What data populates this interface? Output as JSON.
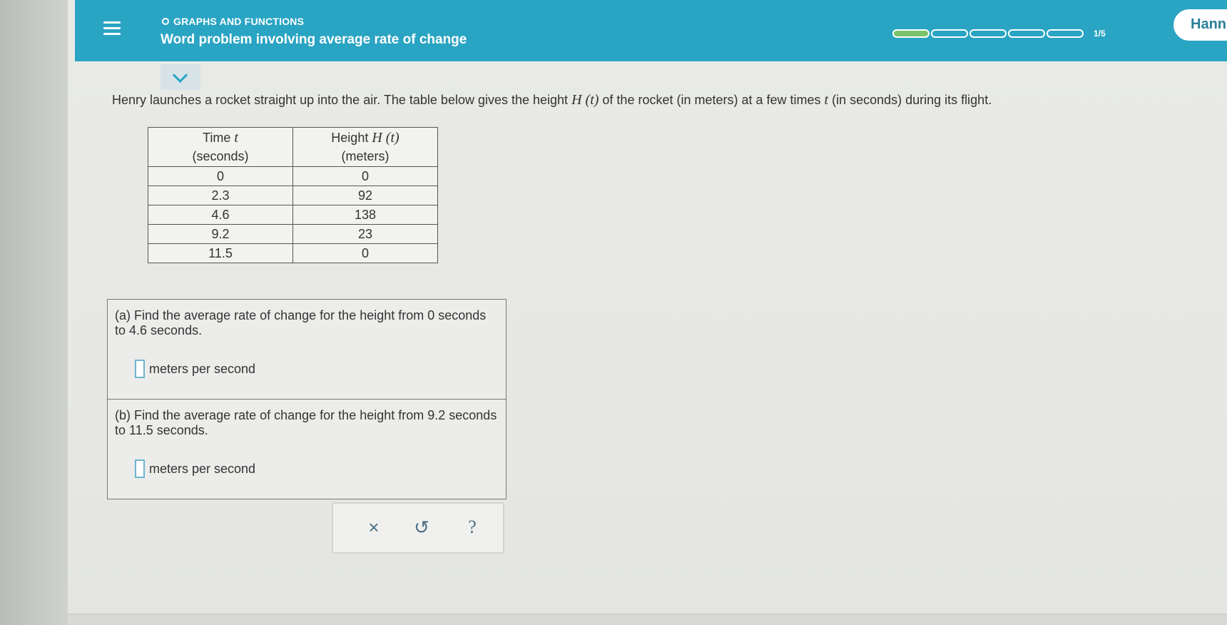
{
  "header": {
    "topic": "GRAPHS AND FUNCTIONS",
    "title": "Word problem involving average rate of change",
    "progress_text": "1/5",
    "progress_filled": 1,
    "progress_total": 5,
    "user_name": "Hann"
  },
  "problem": {
    "part1": "Henry launches a rocket straight up into the air. The table below gives the height ",
    "Hsym": "H",
    "tsym": "t",
    "part2": " of the rocket (in meters) at a few times ",
    "part3": " (in seconds) during its flight."
  },
  "table": {
    "col1_line1": "Time",
    "col1_var": "t",
    "col1_line2": "(seconds)",
    "col2_line1": "Height",
    "col2_var": "H",
    "col2_arg": "t",
    "col2_line2": "(meters)",
    "rows": [
      {
        "t": "0",
        "h": "0"
      },
      {
        "t": "2.3",
        "h": "92"
      },
      {
        "t": "4.6",
        "h": "138"
      },
      {
        "t": "9.2",
        "h": "23"
      },
      {
        "t": "11.5",
        "h": "0"
      }
    ]
  },
  "questions": {
    "a_text": "(a) Find the average rate of change for the height from 0 seconds to 4.6 seconds.",
    "a_unit": "meters per second",
    "b_text": "(b) Find the average rate of change for the height from 9.2 seconds to 11.5 seconds.",
    "b_unit": "meters per second"
  },
  "toolbar": {
    "clear_symbol": "×",
    "undo_symbol": "↺",
    "help_symbol": "?"
  },
  "icons": {
    "menu": "hamburger-icon",
    "collapse": "chevron-down-icon",
    "clear": "close-icon",
    "undo": "undo-icon",
    "help": "help-icon"
  },
  "colors": {
    "header_bg": "#2aa4c3",
    "progress_fill": "#7ac36a",
    "toolbar_icon": "#4d6f86"
  }
}
